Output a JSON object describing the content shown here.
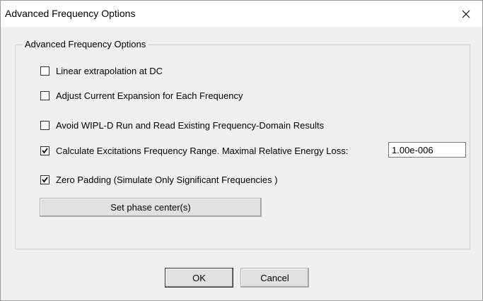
{
  "window": {
    "title": "Advanced Frequency Options",
    "close_icon": "close-icon"
  },
  "group": {
    "legend": "Advanced Frequency Options"
  },
  "options": [
    {
      "label": "Linear extrapolation at DC",
      "checked": false
    },
    {
      "label": "Adjust Current Expansion for Each Frequency",
      "checked": false
    },
    {
      "label": "Avoid WIPL-D Run and Read Existing Frequency-Domain Results",
      "checked": false
    },
    {
      "label": "Calculate Excitations Frequency Range. Maximal Relative Energy Loss:",
      "checked": true
    },
    {
      "label": "Zero Padding (Simulate Only Significant Frequencies )",
      "checked": true
    }
  ],
  "energy_loss": {
    "value": "1.00e-006"
  },
  "buttons": {
    "phase_center": "Set phase center(s)",
    "ok": "OK",
    "cancel": "Cancel"
  }
}
